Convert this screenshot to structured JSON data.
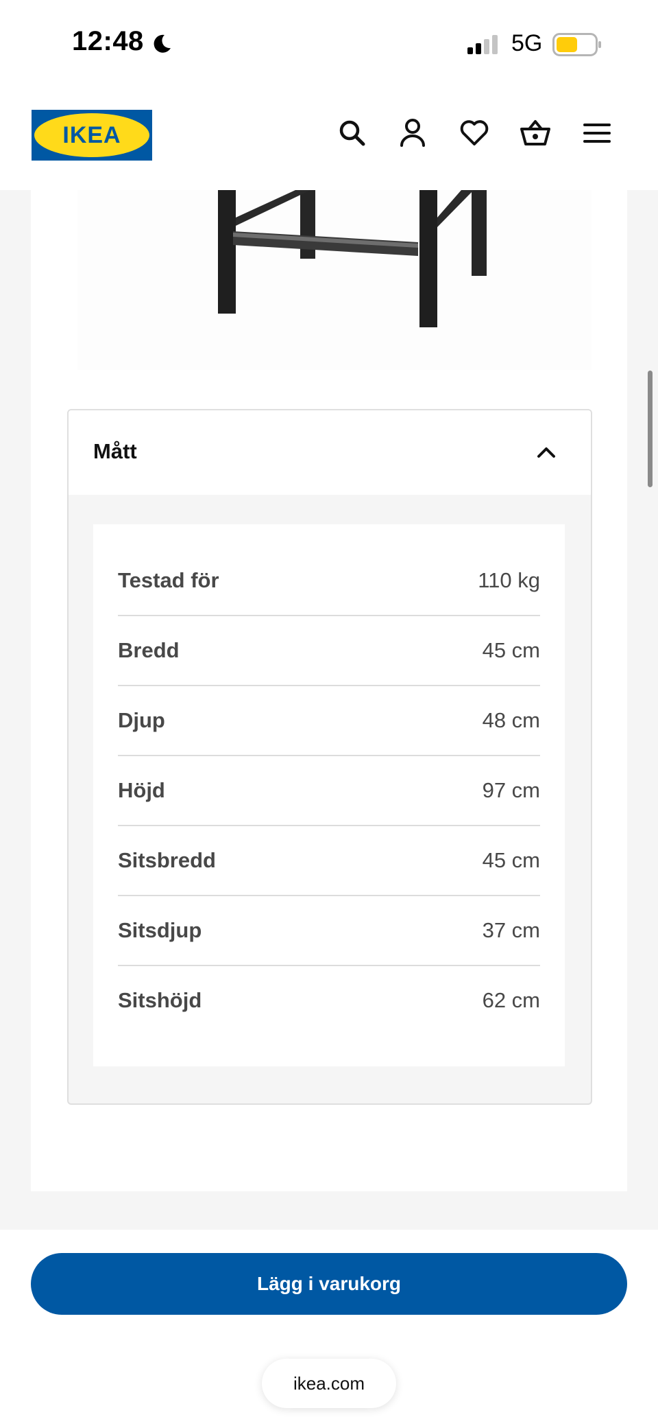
{
  "status_bar": {
    "time": "12:48",
    "network": "5G"
  },
  "brand": {
    "name": "IKEA",
    "blue": "#0058a3",
    "yellow": "#ffda1a"
  },
  "header": {
    "icons": [
      "search-icon",
      "account-icon",
      "heart-icon",
      "basket-icon",
      "menu-icon"
    ]
  },
  "dimensions": {
    "title": "Mått",
    "rows": [
      {
        "label": "Testad för",
        "value": "110 kg"
      },
      {
        "label": "Bredd",
        "value": "45 cm"
      },
      {
        "label": "Djup",
        "value": "48 cm"
      },
      {
        "label": "Höjd",
        "value": "97 cm"
      },
      {
        "label": "Sitsbredd",
        "value": "45 cm"
      },
      {
        "label": "Sitsdjup",
        "value": "37 cm"
      },
      {
        "label": "Sitshöjd",
        "value": "62 cm"
      }
    ]
  },
  "cta": {
    "label": "Lägg i varukorg"
  },
  "browser": {
    "url": "ikea.com"
  }
}
